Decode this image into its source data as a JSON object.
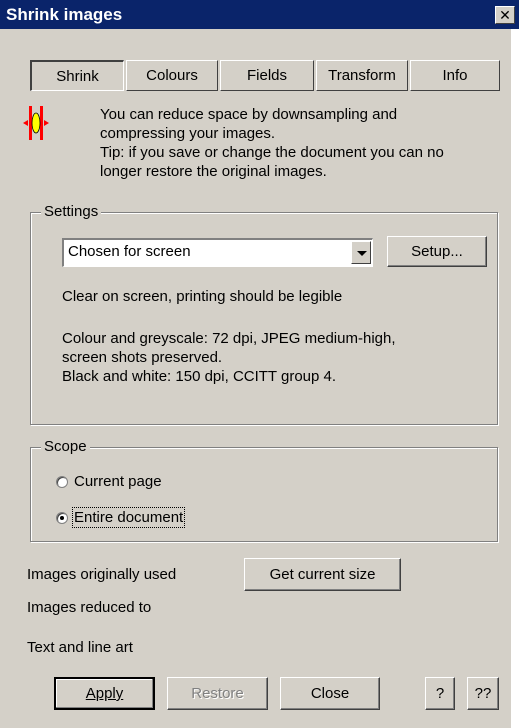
{
  "window": {
    "title": "Shrink images",
    "close_label": "✕"
  },
  "tabs": [
    {
      "label": "Shrink",
      "active": true
    },
    {
      "label": "Colours",
      "active": false
    },
    {
      "label": "Fields",
      "active": false
    },
    {
      "label": "Transform",
      "active": false
    },
    {
      "label": "Info",
      "active": false
    }
  ],
  "intro": {
    "icon": "shrink-arrows-icon",
    "line1": "You can reduce space by downsampling and",
    "line2": "compressing your images.",
    "line3": "Tip: if you save or change the document you can no",
    "line4": "longer restore the original images."
  },
  "settings": {
    "label": "Settings",
    "selected": "Chosen for screen",
    "setup_label": "Setup...",
    "desc1": "Clear on screen, printing should be legible",
    "desc2": "Colour and greyscale: 72 dpi, JPEG medium-high,",
    "desc3": "screen shots preserved.",
    "desc4": "Black and white: 150 dpi, CCITT group 4."
  },
  "scope": {
    "label": "Scope",
    "options": [
      {
        "label": "Current page",
        "selected": false
      },
      {
        "label": "Entire document",
        "selected": true
      }
    ]
  },
  "stats": {
    "originally_used": "Images originally used",
    "get_size_label": "Get current size",
    "reduced_to": "Images reduced to",
    "text_line_art": "Text and line art"
  },
  "buttons": {
    "apply": "Apply",
    "restore": "Restore",
    "close": "Close",
    "help": "?",
    "help2": "??"
  }
}
